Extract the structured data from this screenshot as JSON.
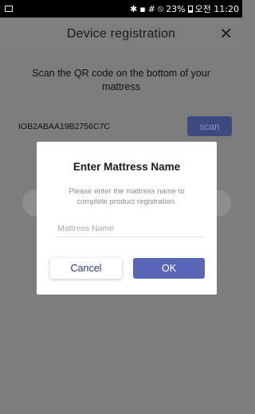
{
  "status_bar": {
    "left_icon": "image-notification-icon",
    "right_text": "✱ ▪ # ⦸ 23% ▮ 오전 11:20",
    "battery": "23%",
    "time": "오전 11:20"
  },
  "header": {
    "title": "Device registration",
    "close_glyph": "✕"
  },
  "main": {
    "instruction": "Scan the QR code on the bottom of your mattress",
    "serial": "IOB2ABAA19B2756C7C",
    "scan_label": "scan"
  },
  "dialog": {
    "title": "Enter Mattress Name",
    "description": "Please enter the mattress name to complete product registration.",
    "input_placeholder": "Mattress Name",
    "input_value": "",
    "cancel_label": "Cancel",
    "ok_label": "OK"
  },
  "colors": {
    "accent": "#5a66b8",
    "dimmed_background": "#7d7d7d",
    "dialog_background": "#ffffff"
  }
}
